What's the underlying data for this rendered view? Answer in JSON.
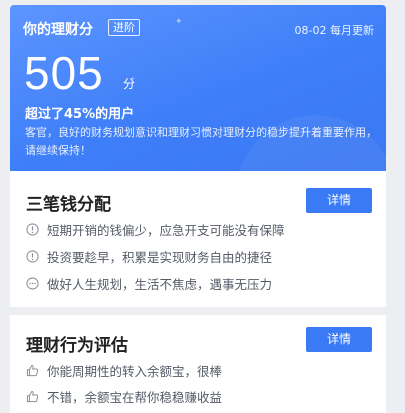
{
  "header": {
    "title": "你的理财分",
    "badge": "进阶",
    "update_note": "08-02 每月更新",
    "score": "505",
    "score_unit": "分",
    "beat_text": "超过了45%的用户",
    "description": "客官，良好的财务规划意识和理财习惯对理财分的稳步提升着重要作用，请继续保持！",
    "bg_color": "#3e7ef8"
  },
  "sections": [
    {
      "title": "三笔钱分配",
      "button_label": "详情",
      "items": [
        {
          "icon": "exclamation-circle-icon",
          "text": "短期开销的钱偏少，应急开支可能没有保障"
        },
        {
          "icon": "exclamation-circle-icon",
          "text": "投资要趁早，积累是实现财务自由的捷径"
        },
        {
          "icon": "ellipsis-circle-icon",
          "text": "做好人生规划，生活不焦虑，遇事无压力"
        }
      ]
    },
    {
      "title": "理财行为评估",
      "button_label": "详情",
      "items": [
        {
          "icon": "thumbs-up-icon",
          "text": "你能周期性的转入余额宝，很棒"
        },
        {
          "icon": "thumbs-up-icon",
          "text": "不错，余额宝在帮你稳稳赚收益"
        }
      ]
    }
  ],
  "colors": {
    "accent": "#3a7af5",
    "page_bg": "#eceef1",
    "text_secondary": "#555b66"
  }
}
